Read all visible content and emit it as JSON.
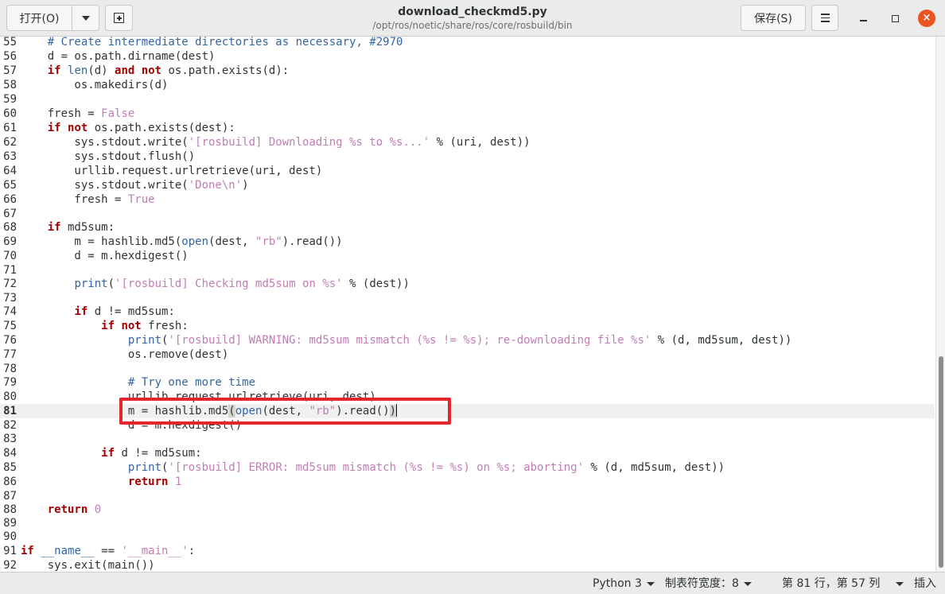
{
  "header": {
    "open_label": "打开(O)",
    "save_label": "保存(S)",
    "title": "download_checkmd5.py",
    "path": "/opt/ros/noetic/share/ros/core/rosbuild/bin",
    "close_glyph": "×"
  },
  "editor": {
    "lines": [
      {
        "n": "55"
      },
      {
        "n": "56"
      },
      {
        "n": "57"
      },
      {
        "n": "58"
      },
      {
        "n": "59"
      },
      {
        "n": "60"
      },
      {
        "n": "61"
      },
      {
        "n": "62"
      },
      {
        "n": "63"
      },
      {
        "n": "64"
      },
      {
        "n": "65"
      },
      {
        "n": "66"
      },
      {
        "n": "67"
      },
      {
        "n": "68"
      },
      {
        "n": "69"
      },
      {
        "n": "70"
      },
      {
        "n": "71"
      },
      {
        "n": "72"
      },
      {
        "n": "73"
      },
      {
        "n": "74"
      },
      {
        "n": "75"
      },
      {
        "n": "76"
      },
      {
        "n": "77"
      },
      {
        "n": "78"
      },
      {
        "n": "79"
      },
      {
        "n": "80"
      },
      {
        "n": "81"
      },
      {
        "n": "82"
      },
      {
        "n": "83"
      },
      {
        "n": "84"
      },
      {
        "n": "85"
      },
      {
        "n": "86"
      },
      {
        "n": "87"
      },
      {
        "n": "88"
      },
      {
        "n": "89"
      },
      {
        "n": "90"
      },
      {
        "n": "91"
      },
      {
        "n": "92"
      }
    ],
    "current_line": "81",
    "highlight_color": "#e3262d"
  },
  "statusbar": {
    "language": "Python 3",
    "tab_width": "制表符宽度：8",
    "position": "第 81 行，第 57 列",
    "insert_mode": "插入"
  }
}
